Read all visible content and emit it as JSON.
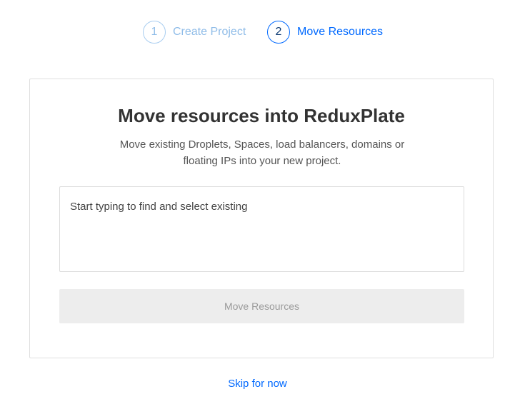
{
  "stepper": {
    "steps": [
      {
        "number": "1",
        "label": "Create Project"
      },
      {
        "number": "2",
        "label": "Move Resources"
      }
    ]
  },
  "card": {
    "title": "Move resources into ReduxPlate",
    "description": "Move existing Droplets, Spaces, load balancers, domains or floating IPs into your new project.",
    "search": {
      "placeholder": "Start typing to find and select existing",
      "value": ""
    },
    "move_button_label": "Move Resources"
  },
  "skip_label": "Skip for now",
  "colors": {
    "accent": "#0069ff",
    "inactive_step": "#8fbce8",
    "disabled_button_bg": "#ededed",
    "disabled_button_text": "#9a9a9a"
  }
}
